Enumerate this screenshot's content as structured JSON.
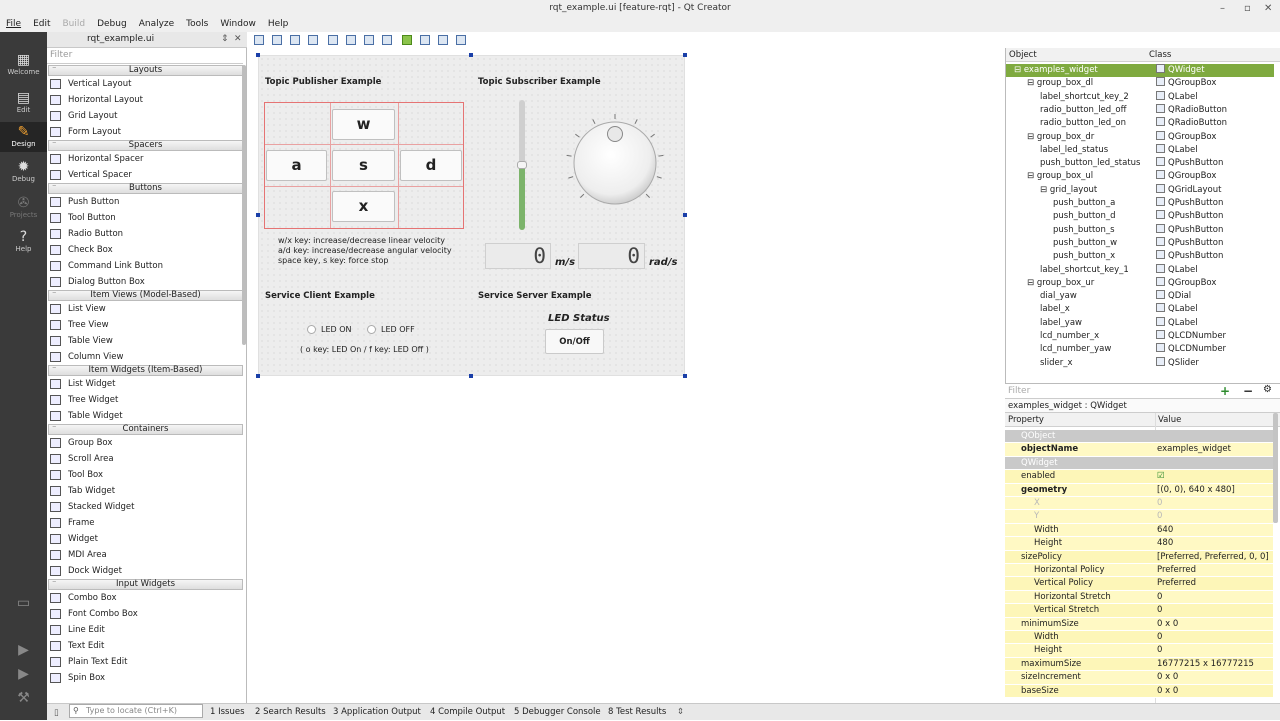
{
  "window": {
    "title": "rqt_example.ui [feature-rqt] - Qt Creator",
    "minimize": "–",
    "maximize": "▫",
    "close": "✕"
  },
  "menu": [
    "File",
    "Edit",
    "Build",
    "Debug",
    "Analyze",
    "Tools",
    "Window",
    "Help"
  ],
  "modes": [
    "Welcome",
    "Edit",
    "Design",
    "Debug",
    "Projects",
    "Help"
  ],
  "editor": {
    "file": "rqt_example.ui"
  },
  "widgetbox": {
    "filter_placeholder": "Filter",
    "categories": [
      {
        "name": "Layouts",
        "items": [
          "Vertical Layout",
          "Horizontal Layout",
          "Grid Layout",
          "Form Layout"
        ]
      },
      {
        "name": "Spacers",
        "items": [
          "Horizontal Spacer",
          "Vertical Spacer"
        ]
      },
      {
        "name": "Buttons",
        "items": [
          "Push Button",
          "Tool Button",
          "Radio Button",
          "Check Box",
          "Command Link Button",
          "Dialog Button Box"
        ]
      },
      {
        "name": "Item Views (Model-Based)",
        "items": [
          "List View",
          "Tree View",
          "Table View",
          "Column View"
        ]
      },
      {
        "name": "Item Widgets (Item-Based)",
        "items": [
          "List Widget",
          "Tree Widget",
          "Table Widget"
        ]
      },
      {
        "name": "Containers",
        "items": [
          "Group Box",
          "Scroll Area",
          "Tool Box",
          "Tab Widget",
          "Stacked Widget",
          "Frame",
          "Widget",
          "MDI Area",
          "Dock Widget"
        ]
      },
      {
        "name": "Input Widgets",
        "items": [
          "Combo Box",
          "Font Combo Box",
          "Line Edit",
          "Text Edit",
          "Plain Text Edit",
          "Spin Box"
        ]
      }
    ]
  },
  "form": {
    "publisher_title": "Topic Publisher Example",
    "subscriber_title": "Topic Subscriber Example",
    "client_title": "Service Client Example",
    "server_title": "Service Server Example",
    "keys": {
      "w": "w",
      "a": "a",
      "s": "s",
      "d": "d",
      "x": "x"
    },
    "note1": "w/x key: increase/decrease linear velocity",
    "note2": "a/d key: increase/decrease angular velocity",
    "note3": "space key, s key: force stop",
    "lcd_x": "0",
    "lcd_x_unit": "m/s",
    "lcd_yaw": "0",
    "lcd_yaw_unit": "rad/s",
    "slider_level": 0.49,
    "led_on": "LED ON",
    "led_off": "LED OFF",
    "led_hint": "( o key: LED On / f key: LED Off )",
    "led_status": "LED Status",
    "led_button": "On/Off"
  },
  "object_inspector": {
    "header_object": "Object",
    "header_class": "Class",
    "rows": [
      {
        "name": "examples_widget",
        "class": "QWidget",
        "selected": true
      },
      {
        "name": "group_box_dl",
        "class": "QGroupBox"
      },
      {
        "name": "label_shortcut_key_2",
        "class": "QLabel"
      },
      {
        "name": "radio_button_led_off",
        "class": "QRadioButton"
      },
      {
        "name": "radio_button_led_on",
        "class": "QRadioButton"
      },
      {
        "name": "group_box_dr",
        "class": "QGroupBox"
      },
      {
        "name": "label_led_status",
        "class": "QLabel"
      },
      {
        "name": "push_button_led_status",
        "class": "QPushButton"
      },
      {
        "name": "group_box_ul",
        "class": "QGroupBox"
      },
      {
        "name": "grid_layout",
        "class": "QGridLayout"
      },
      {
        "name": "push_button_a",
        "class": "QPushButton"
      },
      {
        "name": "push_button_d",
        "class": "QPushButton"
      },
      {
        "name": "push_button_s",
        "class": "QPushButton"
      },
      {
        "name": "push_button_w",
        "class": "QPushButton"
      },
      {
        "name": "push_button_x",
        "class": "QPushButton"
      },
      {
        "name": "label_shortcut_key_1",
        "class": "QLabel"
      },
      {
        "name": "group_box_ur",
        "class": "QGroupBox"
      },
      {
        "name": "dial_yaw",
        "class": "QDial"
      },
      {
        "name": "label_x",
        "class": "QLabel"
      },
      {
        "name": "label_yaw",
        "class": "QLabel"
      },
      {
        "name": "lcd_number_x",
        "class": "QLCDNumber"
      },
      {
        "name": "lcd_number_yaw",
        "class": "QLCDNumber"
      },
      {
        "name": "slider_x",
        "class": "QSlider"
      }
    ]
  },
  "property_editor": {
    "filter_placeholder": "Filter",
    "class_line": "examples_widget : QWidget",
    "header_property": "Property",
    "header_value": "Value",
    "rows": [
      {
        "name": "QObject",
        "value": "",
        "type": "group"
      },
      {
        "name": "objectName",
        "value": "examples_widget",
        "type": "bold"
      },
      {
        "name": "QWidget",
        "value": "",
        "type": "group"
      },
      {
        "name": "enabled",
        "value": "☑",
        "type": "y2"
      },
      {
        "name": "geometry",
        "value": "[(0, 0), 640 x 480]",
        "type": "bold"
      },
      {
        "name": "X",
        "value": "0",
        "type": "dis"
      },
      {
        "name": "Y",
        "value": "0",
        "type": "dis"
      },
      {
        "name": "Width",
        "value": "640",
        "type": "sub"
      },
      {
        "name": "Height",
        "value": "480",
        "type": "sub"
      },
      {
        "name": "sizePolicy",
        "value": "[Preferred, Preferred, 0, 0]",
        "type": "y2"
      },
      {
        "name": "Horizontal Policy",
        "value": "Preferred",
        "type": "sub"
      },
      {
        "name": "Vertical Policy",
        "value": "Preferred",
        "type": "sub2"
      },
      {
        "name": "Horizontal Stretch",
        "value": "0",
        "type": "sub"
      },
      {
        "name": "Vertical Stretch",
        "value": "0",
        "type": "sub2"
      },
      {
        "name": "minimumSize",
        "value": "0 x 0",
        "type": "y"
      },
      {
        "name": "Width",
        "value": "0",
        "type": "sub2"
      },
      {
        "name": "Height",
        "value": "0",
        "type": "sub"
      },
      {
        "name": "maximumSize",
        "value": "16777215 x 16777215",
        "type": "y2"
      },
      {
        "name": "sizeIncrement",
        "value": "0 x 0",
        "type": "y"
      },
      {
        "name": "baseSize",
        "value": "0 x 0",
        "type": "y2"
      }
    ]
  },
  "statusbar": {
    "locate_placeholder": "Type to locate (Ctrl+K)",
    "tabs": [
      "1  Issues",
      "2  Search Results",
      "3  Application Output",
      "4  Compile Output",
      "5  Debugger Console",
      "8  Test Results"
    ]
  }
}
